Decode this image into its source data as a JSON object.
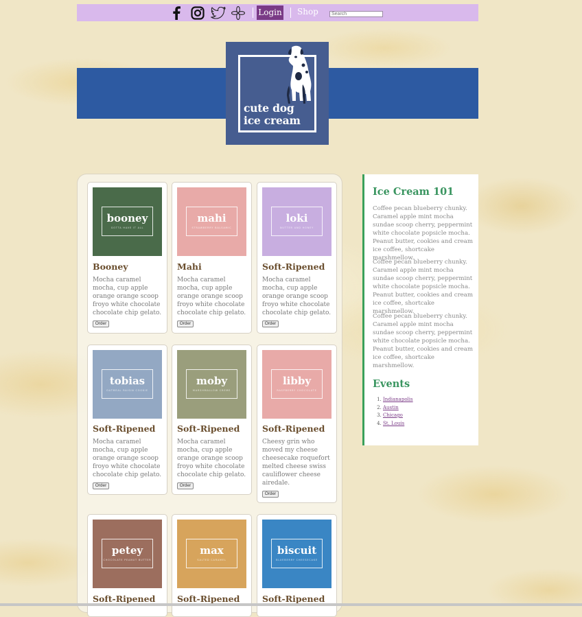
{
  "nav": {
    "social": [
      {
        "icon": "facebook-icon"
      },
      {
        "icon": "instagram-icon"
      },
      {
        "icon": "twitter-icon"
      },
      {
        "icon": "yelp-icon"
      }
    ],
    "login_label": "Login",
    "shop_label": "Shop",
    "search_placeholder": "Search"
  },
  "logo": {
    "line1": "cute dog",
    "line2": "ice cream"
  },
  "products": [
    {
      "thumb_name": "booney",
      "thumb_tag": "GOTTA HAVE IT ALL",
      "color": "#4a6b4a",
      "title": "Booney",
      "desc": "Mocha caramel mocha, cup apple orange orange scoop froyo white chocolate chocolate chip gelato.",
      "order_label": "Order"
    },
    {
      "thumb_name": "mahi",
      "thumb_tag": "STRAWBERRY BALSAMIC",
      "color": "#e8aaa8",
      "title": "Mahi",
      "desc": "Mocha caramel mocha, cup apple orange orange scoop froyo white chocolate chocolate chip gelato.",
      "order_label": "Order"
    },
    {
      "thumb_name": "loki",
      "thumb_tag": "NUTTER AND HONEY",
      "color": "#c8aee0",
      "title": "Soft-Ripened",
      "desc": "Mocha caramel mocha, cup apple orange orange scoop froyo white chocolate chocolate chip gelato.",
      "order_label": "Order"
    },
    {
      "thumb_name": "tobias",
      "thumb_tag": "OATMEAL RAISIN COOKIE",
      "color": "#93a8c3",
      "title": "Soft-Ripened",
      "desc": "Mocha caramel mocha, cup apple orange orange scoop froyo white chocolate chocolate chip gelato.",
      "order_label": "Order"
    },
    {
      "thumb_name": "moby",
      "thumb_tag": "MARSHMALLOW CREME",
      "color": "#9a9e7c",
      "title": "Soft-Ripened",
      "desc": "Mocha caramel mocha, cup apple orange orange scoop froyo white chocolate chocolate chip gelato.",
      "order_label": "Order"
    },
    {
      "thumb_name": "libby",
      "thumb_tag": "RASPBERRY CHOCOLATE",
      "color": "#e8aaa8",
      "title": "Soft-Ripened",
      "desc": "Cheesy grin who moved my cheese cheesecake roquefort melted cheese swiss cauliflower cheese airedale.",
      "order_label": "Order"
    },
    {
      "thumb_name": "petey",
      "thumb_tag": "CHOCOLATE PEANUT BUTTER",
      "color": "#9c6e5e",
      "title": "Soft-Ripened",
      "desc": "",
      "order_label": ""
    },
    {
      "thumb_name": "max",
      "thumb_tag": "SALTED CARAMEL",
      "color": "#d7a45c",
      "title": "Soft-Ripened",
      "desc": "",
      "order_label": ""
    },
    {
      "thumb_name": "biscuit",
      "thumb_tag": "BLUEBERRY CHEESECAKE",
      "color": "#3a86c4",
      "title": "Soft-Ripened",
      "desc": "",
      "order_label": ""
    }
  ],
  "sidebar": {
    "title": "Ice Cream 101",
    "paragraphs": [
      "Coffee pecan blueberry chunky. Caramel apple mint mocha sundae scoop cherry, peppermint white chocolate popsicle mocha. Peanut butter, cookies and cream ice coffee, shortcake marshmellow.",
      "Coffee pecan blueberry chunky. Caramel apple mint mocha sundae scoop cherry, peppermint white chocolate popsicle mocha. Peanut butter, cookies and cream ice coffee, shortcake marshmellow.",
      "Coffee pecan blueberry chunky. Caramel apple mint mocha sundae scoop cherry, peppermint white chocolate popsicle mocha. Peanut butter, cookies and cream ice coffee, shortcake marshmellow."
    ],
    "events_title": "Events",
    "events": [
      "Indianapolis",
      "Austin",
      "Chicago",
      "St. Louis"
    ]
  },
  "colors": {
    "nav_bg": "#d9b9ec",
    "login_bg": "#7a3a86",
    "banner": "#2d5aa2",
    "logo_bg": "#465d90",
    "accent_green": "#3aa05a"
  }
}
